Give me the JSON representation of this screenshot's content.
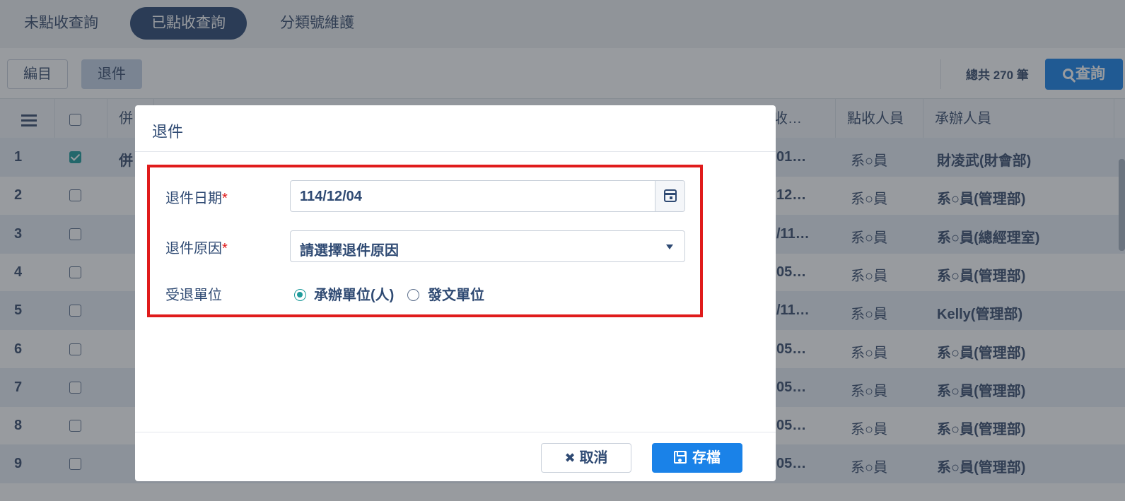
{
  "tabs": [
    {
      "label": "未點收查詢"
    },
    {
      "label": "已點收查詢"
    },
    {
      "label": "分類號維護"
    }
  ],
  "toolbar": {
    "catalog_label": "編目",
    "return_label": "退件",
    "total_label": "總共 270 筆",
    "query_label": "查詢"
  },
  "grid": {
    "headers": {
      "merge": "併",
      "received_date": "收…",
      "clerk": "點收人員",
      "handler": "承辦人員"
    },
    "rows": [
      {
        "num": "1",
        "checked": true,
        "merge": "併",
        "date": "01…",
        "clerk": "系○員",
        "handler": "財凌武(財會部)"
      },
      {
        "num": "2",
        "checked": false,
        "merge": "",
        "date": "12…",
        "clerk": "系○員",
        "handler": "系○員(管理部)"
      },
      {
        "num": "3",
        "checked": false,
        "merge": "",
        "date": "/11…",
        "clerk": "系○員",
        "handler": "系○員(總經理室)"
      },
      {
        "num": "4",
        "checked": false,
        "merge": "",
        "date": "05…",
        "clerk": "系○員",
        "handler": "系○員(管理部)"
      },
      {
        "num": "5",
        "checked": false,
        "merge": "",
        "date": "/11…",
        "clerk": "系○員",
        "handler": "Kelly(管理部)"
      },
      {
        "num": "6",
        "checked": false,
        "merge": "",
        "date": "05…",
        "clerk": "系○員",
        "handler": "系○員(管理部)"
      },
      {
        "num": "7",
        "checked": false,
        "merge": "",
        "date": "05…",
        "clerk": "系○員",
        "handler": "系○員(管理部)"
      },
      {
        "num": "8",
        "checked": false,
        "merge": "",
        "date": "05…",
        "clerk": "系○員",
        "handler": "系○員(管理部)"
      },
      {
        "num": "9",
        "checked": false,
        "merge": "",
        "date": "05…",
        "clerk": "系○員",
        "handler": "系○員(管理部)"
      }
    ]
  },
  "modal": {
    "title": "退件",
    "return_date_label": "退件日期",
    "return_date_value": "114/12/04",
    "return_reason_label": "退件原因",
    "return_reason_placeholder": "請選擇退件原因",
    "recipient_label": "受退單位",
    "recipient_options": [
      "承辦單位(人)",
      "發文單位"
    ],
    "recipient_selected": "承辦單位(人)",
    "required_mark": "*",
    "cancel_label": "取消",
    "save_label": "存檔",
    "highlight_color": "#e01b1b",
    "primary_color": "#1a82e8"
  },
  "icons": {
    "cancel": "✖",
    "calendar": "calendar-icon",
    "save": "floppy-disk-icon",
    "search": "search-icon"
  }
}
